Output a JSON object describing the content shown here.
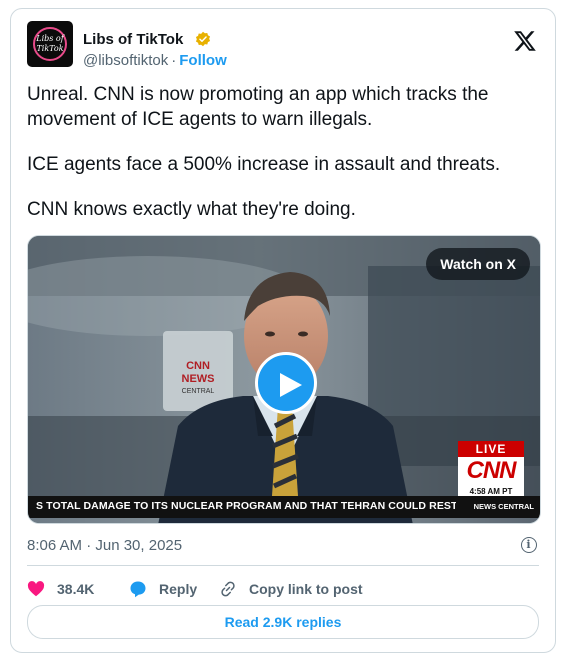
{
  "account": {
    "name": "Libs of TikTok",
    "handle": "@libsoftiktok",
    "separator": "·",
    "follow_label": "Follow",
    "avatar_text_line1": "Libs of",
    "avatar_text_line2": "TikTok"
  },
  "tweet": {
    "paragraphs": [
      "Unreal. CNN is now promoting an app which tracks the movement of ICE agents to warn illegals.",
      "ICE agents face a 500% increase in assault and threats.",
      "CNN knows exactly what they're doing."
    ],
    "timestamp": "8:06 AM · Jun 30, 2025"
  },
  "media": {
    "watch_label": "Watch on X",
    "ticker": "S TOTAL DAMAGE TO ITS NUCLEAR PROGRAM AND THAT TEHRAN COULD RESTART ENI",
    "news_central": "NEWS CENTRAL",
    "live_label": "LIVE",
    "network": "CNN",
    "live_time": "4:58 AM PT",
    "wall_logo_line1": "CNN",
    "wall_logo_line2": "NEWS",
    "wall_logo_line3": "CENTRAL"
  },
  "actions": {
    "likes": "38.4K",
    "reply_label": "Reply",
    "copy_label": "Copy link to post",
    "read_replies": "Read 2.9K replies"
  },
  "colors": {
    "accent": "#1d9bf0",
    "like": "#f91880",
    "text": "#0f1419",
    "muted": "#536471",
    "border": "#cfd9de"
  }
}
